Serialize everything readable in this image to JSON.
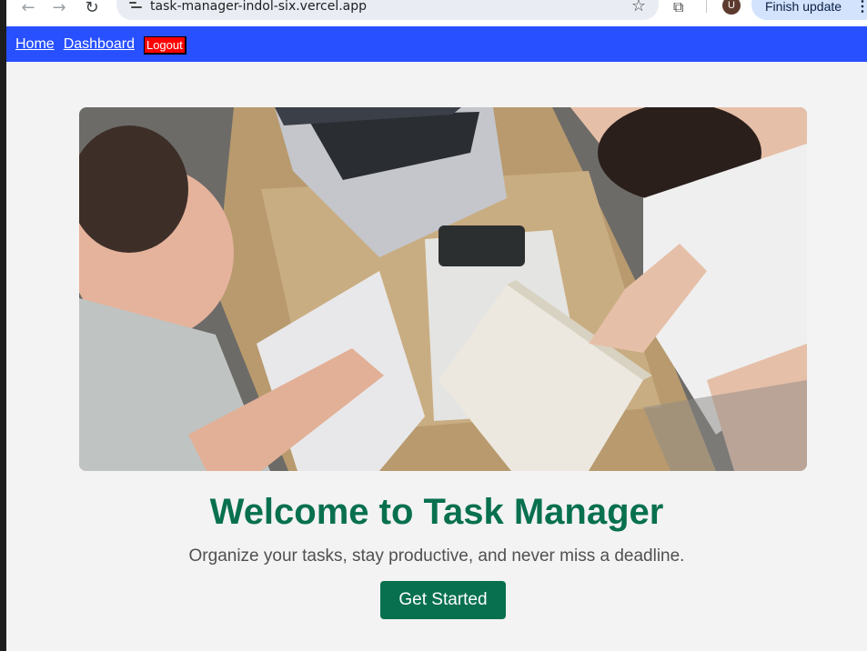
{
  "browser": {
    "url": "task-manager-indol-six.vercel.app",
    "avatar_letter": "U",
    "update_label": "Finish update",
    "back_glyph": "←",
    "forward_glyph": "→",
    "reload_glyph": "↻",
    "star_glyph": "☆",
    "extensions_glyph": "⧉",
    "menu_glyph": "⋮"
  },
  "nav": {
    "home": "Home",
    "dashboard": "Dashboard",
    "logout": "Logout",
    "bar_color": "#2850ff",
    "logout_color": "#ff0000"
  },
  "hero": {
    "image": "people-studying-at-desk-photo"
  },
  "main": {
    "title": "Welcome to Task Manager",
    "subtitle": "Organize your tasks, stay productive, and never miss a deadline.",
    "cta": "Get Started",
    "accent_color": "#08704f"
  }
}
